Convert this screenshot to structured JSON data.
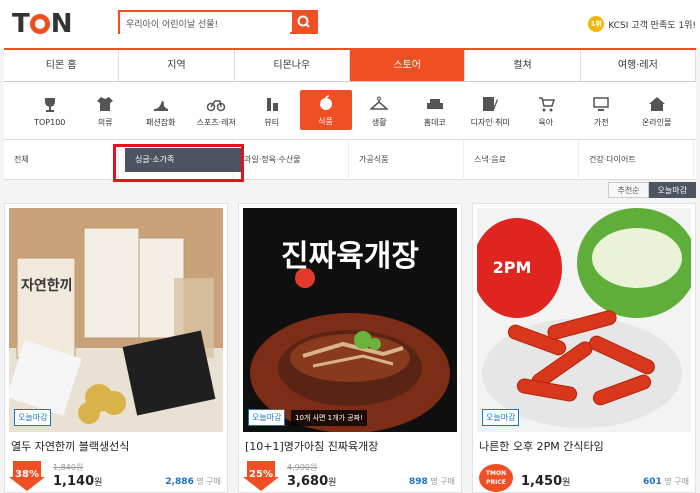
{
  "header": {
    "logo": "TMON",
    "search_placeholder": "우리아이 어린이날 선물!",
    "medal": "1위",
    "kcsi": "KCSI 고객 만족도 1위!"
  },
  "gnb": [
    "티몬 홈",
    "지역",
    "티몬나우",
    "스토어",
    "컬쳐",
    "여행·레저"
  ],
  "categories": [
    "TOP100",
    "의류",
    "패션잡화",
    "스포츠·레저",
    "뷰티",
    "식품",
    "생활",
    "홈데코",
    "디자인·취미",
    "육아",
    "가전",
    "온라인몰"
  ],
  "subcategories": [
    "전체",
    "싱글·소가족",
    "과일·정육·수산물",
    "가공식품",
    "스낵·음료",
    "건강·다이어트"
  ],
  "sort": {
    "recommend": "추천순",
    "today_close": "오늘마감"
  },
  "products": [
    {
      "title": "열두 자연한끼 블랙생선식",
      "badge": "오늘마감",
      "discount": "38%",
      "original_price": "1,840원",
      "price": "1,140",
      "won": "원",
      "buy_count": "2,886",
      "buy_label": "명 구매",
      "img_text": "자연한끼"
    },
    {
      "title": "[10+1]명가아침 진짜육개장",
      "badge": "오늘마감",
      "note": "10개 사면 1개가 공짜!",
      "discount": "25%",
      "original_price": "4,900원",
      "price": "3,680",
      "won": "원",
      "buy_count": "898",
      "buy_label": "명 구매",
      "img_text": "진짜육개장"
    },
    {
      "title": "나른한 오후 2PM 간식타임",
      "badge": "오늘마감",
      "price_badge": "TMON PRICE",
      "price": "1,450",
      "won": "원",
      "buy_count": "601",
      "buy_label": "명 구매",
      "img_text": "2PM"
    }
  ],
  "colors": {
    "brand": "#f04e23",
    "dark": "#4e5360",
    "highlight": "#e0141e",
    "link": "#1a73c7"
  }
}
